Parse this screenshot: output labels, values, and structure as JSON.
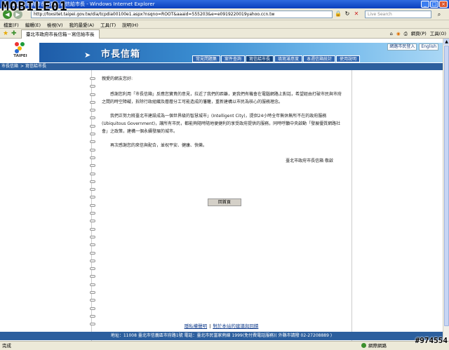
{
  "browser": {
    "title": "臺北市政府市長信箱－寫信給市長 - Windows Internet Explorer",
    "address": "http://foxsitet.taipei.gov.tw/dia/tcpdia00100e1.aspx?nsqno=ROOT&aaaid=555203&e=e0919220019yahoo.ccn.tw",
    "search_placeholder": "Live Search",
    "menu": [
      "檔案(F)",
      "編輯(E)",
      "檢視(V)",
      "我的最愛(A)",
      "工具(T)",
      "說明(H)"
    ],
    "tab_label": "臺北市政府市長信箱－寫信給市長",
    "cmd_page": "網頁(P)",
    "cmd_tools": "工具(O)",
    "status_text": "完成",
    "zone_text": "網際網路"
  },
  "site": {
    "logo_text": "TAIPEI",
    "banner_title": "市長信箱",
    "top_links": [
      "網路市民登入",
      "English"
    ],
    "tabs": [
      "常見問題集",
      "案件查詢",
      "寫信給市長",
      "填寫滿意度",
      "本週信箱統計",
      "使用說明"
    ],
    "active_tab_index": 2,
    "breadcrumb": [
      "市長信箱",
      "寫信給市長"
    ]
  },
  "letter": {
    "greeting": "親愛的網友您好:",
    "para1": "感謝您利用「市長信箱」反應您寶貴的意見，拉近了我們的距離，更我們有機會在電腦網路上對話，希望經由打破市民與市府之間的時空障礙，拆除行政組織及層層分工可能造成的藩籬，重新建構以市民為核心的服務理念。",
    "para2": "我們正努力將臺北市建設成為一個世界級的智慧城市」(Intelligent City)，提供24小時全年無休無所不在的政府服務 (Ubiquitous Government)，讓所有市民，都能夠隨時隨地便捷利的享受政府提供的服務，同時呼籲中央啟動「發展優質網路社會」之政策，建構一個永續發展的城市。",
    "para3": "再次感謝您的來信與配合，並祝平安、健康、快樂。",
    "signature": "臺北市政府市長信箱  敬啟",
    "home_button": "回首頁"
  },
  "footer": {
    "links": [
      "隱私權聲明",
      "對於本站的建議與回饋"
    ],
    "address": "地址：11008 臺北市信義區市府路1號 電話：臺北市民當家熱線 1999(免付費電話服務)( 外縣市請撥 02-27208889 )"
  },
  "watermark": {
    "logo": "MOBILE01",
    "id": "#974554"
  }
}
